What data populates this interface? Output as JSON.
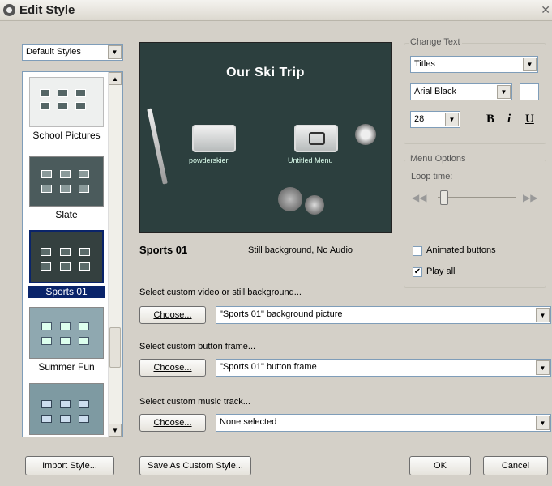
{
  "window": {
    "title": "Edit Style"
  },
  "styles_dropdown": {
    "value": "Default Styles"
  },
  "style_list": {
    "items": [
      {
        "caption": "School Pictures",
        "selected": false,
        "bg": "#e8ecec"
      },
      {
        "caption": "Slate",
        "selected": false,
        "bg": "#4b5b5c"
      },
      {
        "caption": "Sports 01",
        "selected": true,
        "bg": "#34403f"
      },
      {
        "caption": "Summer Fun",
        "selected": false,
        "bg": "#8fa8b0"
      },
      {
        "caption": "",
        "selected": false,
        "bg": "#7e9aa2"
      }
    ]
  },
  "preview": {
    "title": "Our Ski Trip",
    "button1_label": "powderskier",
    "button2_label": "Untitled Menu"
  },
  "style_info": {
    "name": "Sports 01",
    "description": "Still background, No Audio"
  },
  "background": {
    "prompt": "Select custom video or still background...",
    "choose_label": "Choose...",
    "value": "\"Sports 01\" background picture"
  },
  "button_frame": {
    "prompt": "Select custom button frame...",
    "choose_label": "Choose...",
    "value": "\"Sports 01\" button frame"
  },
  "music": {
    "prompt": "Select custom music track...",
    "choose_label": "Choose...",
    "value": "None selected"
  },
  "change_text": {
    "group_label": "Change Text",
    "target": "Titles",
    "font": "Arial Black",
    "size": "28",
    "bold": "B",
    "italic": "i",
    "underline": "U"
  },
  "menu_options": {
    "group_label": "Menu Options",
    "loop_label": "Loop time:",
    "loop_value": 0.05,
    "animated_label": "Animated buttons",
    "animated_checked": false,
    "playall_label": "Play all",
    "playall_checked": true
  },
  "footer": {
    "import_label": "Import Style...",
    "save_label": "Save As Custom Style...",
    "ok_label": "OK",
    "cancel_label": "Cancel"
  }
}
